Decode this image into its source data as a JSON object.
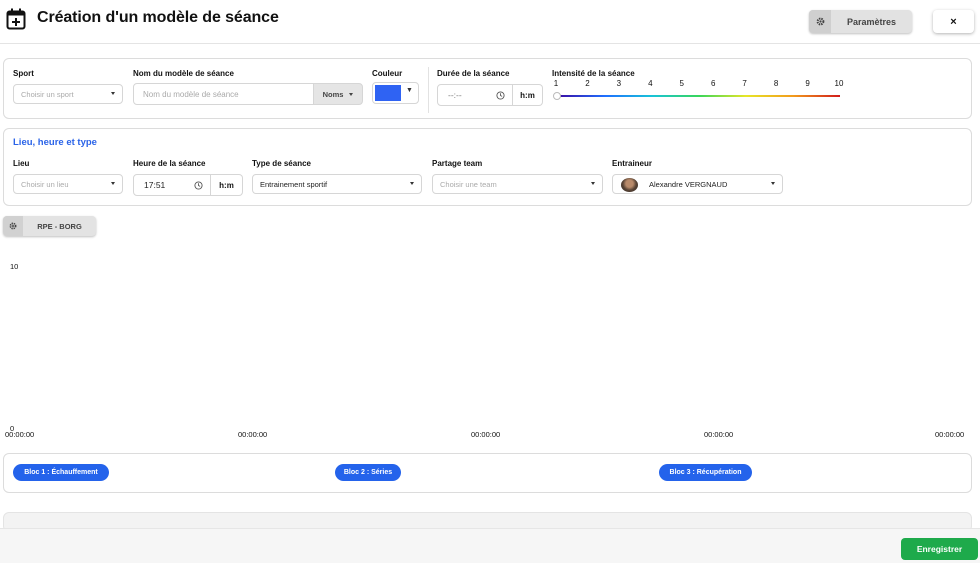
{
  "header": {
    "title": "Création d'un modèle de séance",
    "params_label": "Paramètres",
    "close_label": "×"
  },
  "general": {
    "sport_label": "Sport",
    "sport_placeholder": "Choisir un sport",
    "name_label": "Nom du modèle de séance",
    "name_placeholder": "Nom du modèle de séance",
    "name_addon": "Noms",
    "color_label": "Couleur",
    "color_value": "#2f63f3",
    "duration_label": "Durée de la séance",
    "duration_value": "--:--",
    "duration_unit": "h:m",
    "intensity_label": "Intensité de la séance",
    "intensity_ticks": [
      "1",
      "2",
      "3",
      "4",
      "5",
      "6",
      "7",
      "8",
      "9",
      "10"
    ],
    "intensity_value": 1
  },
  "location": {
    "section_title": "Lieu, heure et type",
    "place_label": "Lieu",
    "place_placeholder": "Choisir un lieu",
    "time_label": "Heure de la séance",
    "time_value": "17:51",
    "time_unit": "h:m",
    "type_label": "Type de séance",
    "type_value": "Entrainement sportif",
    "team_label": "Partage team",
    "team_placeholder": "Choisir une team",
    "coach_label": "Entraineur",
    "coach_value": "Alexandre VERGNAUD"
  },
  "rpe": {
    "button_label": "RPE - BORG"
  },
  "chart_data": {
    "type": "area",
    "y_ticks": [
      "10",
      "0"
    ],
    "ylim": [
      0,
      10
    ],
    "x_ticks": [
      "00:00:00",
      "00:00:00",
      "00:00:00",
      "00:00:00",
      "00:00:00"
    ],
    "series": []
  },
  "blocs": [
    "Bloc 1 : Échauffement",
    "Bloc 2 : Séries",
    "Bloc 3 : Récupération"
  ],
  "footer": {
    "save_label": "Enregistrer"
  },
  "colors": {
    "accent": "#2463eb",
    "save": "#1eaa4b"
  }
}
